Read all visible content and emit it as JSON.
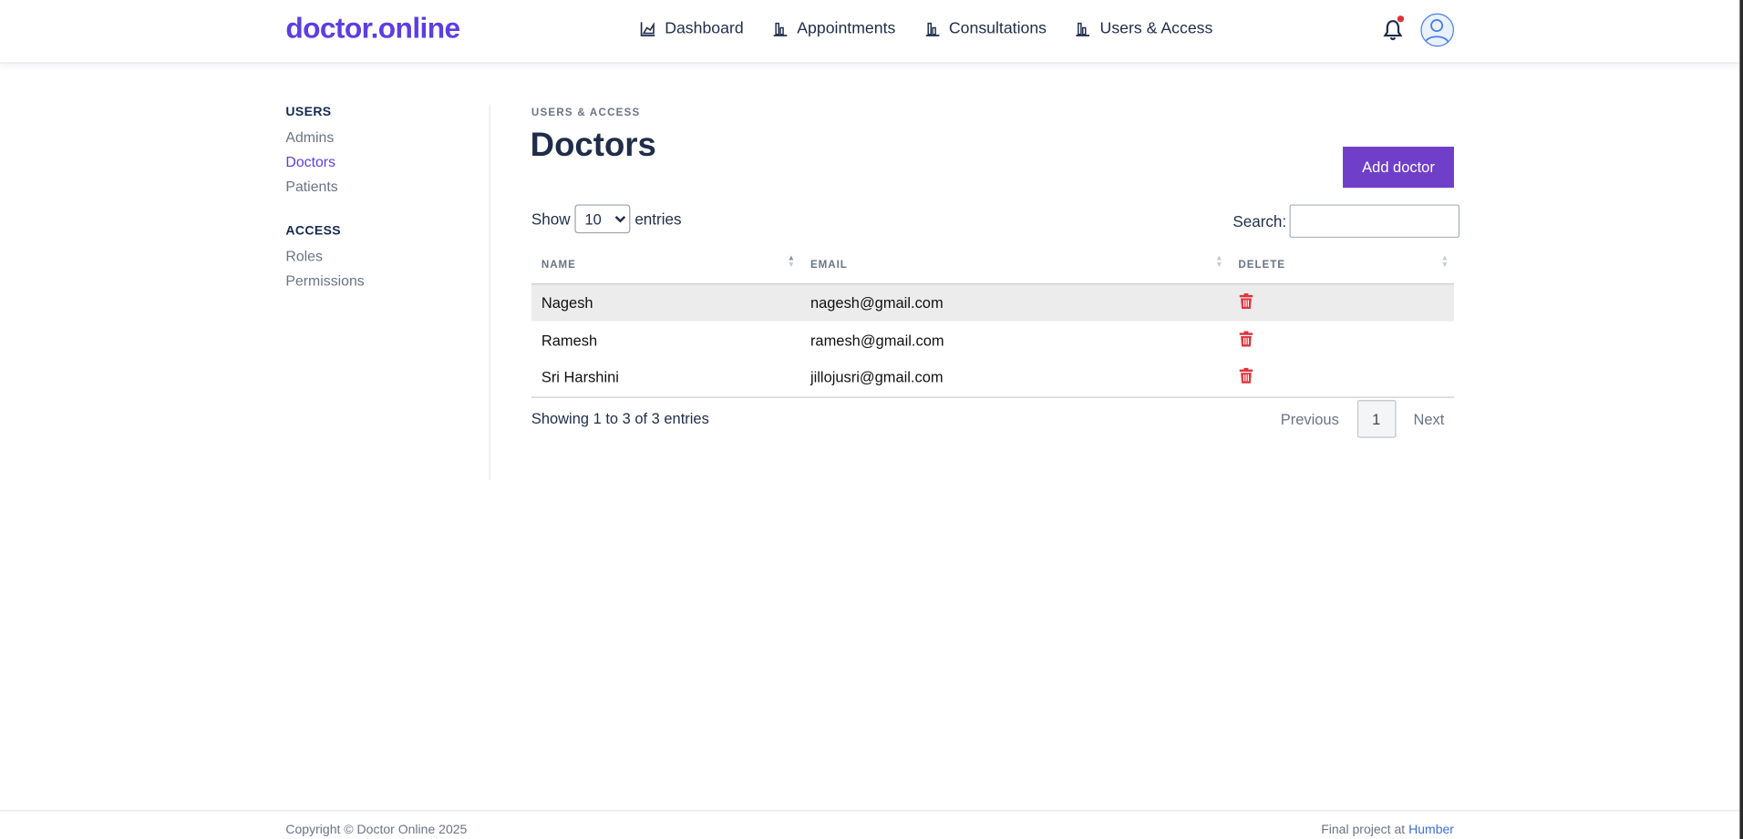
{
  "header": {
    "logo": "doctor.online",
    "nav": [
      {
        "label": "Dashboard",
        "icon": "area-chart-icon"
      },
      {
        "label": "Appointments",
        "icon": "bar-chart-icon"
      },
      {
        "label": "Consultations",
        "icon": "bar-chart-icon"
      },
      {
        "label": "Users & Access",
        "icon": "bar-chart-icon"
      }
    ],
    "notification_icon": "bell-icon",
    "avatar_icon": "user-avatar-icon"
  },
  "sidebar": {
    "users_heading": "USERS",
    "users_items": [
      {
        "label": "Admins",
        "active": false
      },
      {
        "label": "Doctors",
        "active": true
      },
      {
        "label": "Patients",
        "active": false
      }
    ],
    "access_heading": "ACCESS",
    "access_items": [
      {
        "label": "Roles"
      },
      {
        "label": "Permissions"
      }
    ]
  },
  "main": {
    "breadcrumb": "USERS & ACCESS",
    "title": "Doctors",
    "add_button": "Add doctor",
    "show_label": "Show",
    "entries_label": "entries",
    "page_length": "10",
    "search_label": "Search:",
    "search_value": "",
    "columns": [
      "NAME",
      "EMAIL",
      "DELETE"
    ],
    "rows": [
      {
        "name": "Nagesh",
        "email": "nagesh@gmail.com"
      },
      {
        "name": "Ramesh",
        "email": "ramesh@gmail.com"
      },
      {
        "name": "Sri Harshini",
        "email": "jillojusri@gmail.com"
      }
    ],
    "info": "Showing 1 to 3 of 3 entries",
    "pagination": {
      "previous": "Previous",
      "current": "1",
      "next": "Next"
    }
  },
  "footer": {
    "copyright": "Copyright © Doctor Online 2025",
    "credit_prefix": "Final project at",
    "credit_link": "Humber"
  },
  "colors": {
    "brand": "#5b3fe0",
    "button": "#6f3fc9",
    "danger": "#e0343b",
    "link": "#3d6fdc"
  }
}
